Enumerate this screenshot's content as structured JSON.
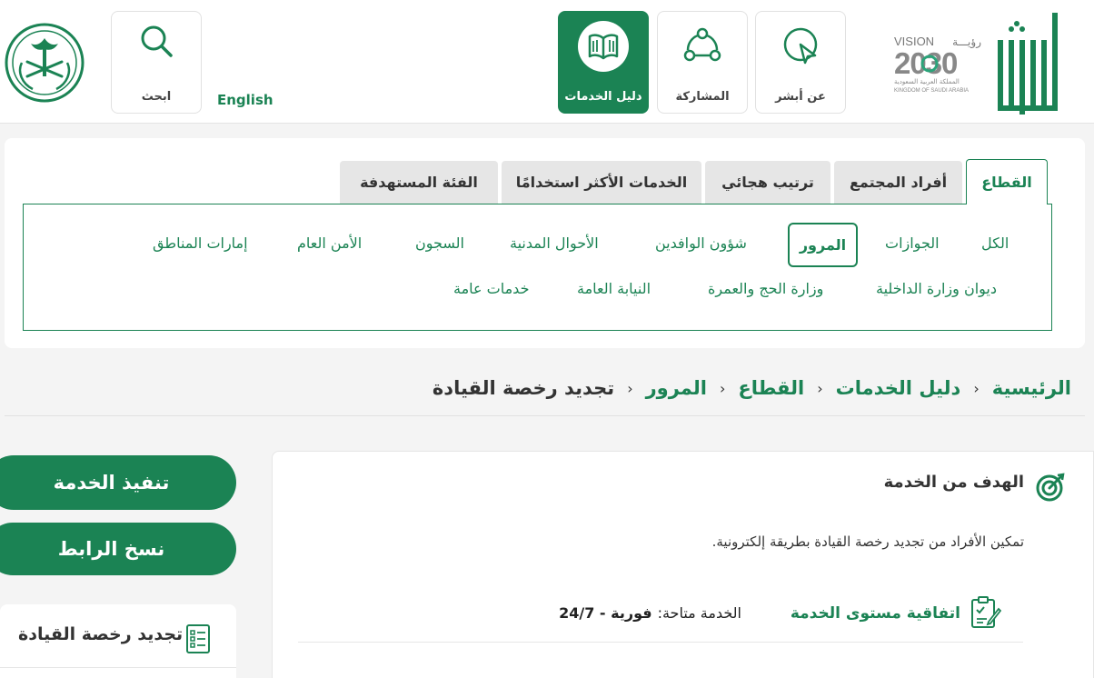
{
  "header": {
    "nav": {
      "about": "عن أبشر",
      "participation": "المشاركة",
      "services_guide": "دليل الخدمات",
      "search": "ابحث"
    },
    "language": "English",
    "vision": {
      "line1": "VISION",
      "line1_ar": "رؤيـــة",
      "year": "2030",
      "country_ar": "المملكة العربية السعودية",
      "country_en": "KINGDOM OF SAUDI ARABIA"
    }
  },
  "tabs": [
    "القطاع",
    "أفراد المجتمع",
    "ترتيب هجائي",
    "الخدمات الأكثر استخدامًا",
    "الفئة المستهدفة"
  ],
  "sectors": {
    "row1": [
      "الكل",
      "الجوازات",
      "المرور",
      "شؤون الوافدين",
      "الأحوال المدنية",
      "السجون",
      "الأمن العام",
      "إمارات المناطق"
    ],
    "row2": [
      "ديوان وزارة الداخلية",
      "وزارة الحج والعمرة",
      "النيابة العامة",
      "خدمات عامة"
    ]
  },
  "breadcrumb": [
    "الرئيسية",
    "دليل الخدمات",
    "القطاع",
    "المرور",
    "تجديد رخصة القيادة"
  ],
  "actions": {
    "execute": "تنفيذ الخدمة",
    "copy_link": "نسخ الرابط"
  },
  "side_card": {
    "title": "تجديد رخصة القيادة"
  },
  "service": {
    "goal_title": "الهدف من الخدمة",
    "goal_text": "تمكين الأفراد من تجديد رخصة القيادة بطريقة إلكترونية.",
    "sla_label": "اتفاقية مستوى الخدمة",
    "sla_key": "الخدمة متاحة:",
    "sla_value": "فورية - 24/7"
  },
  "colors": {
    "primary": "#1b8354",
    "background": "#f4f4f4"
  }
}
